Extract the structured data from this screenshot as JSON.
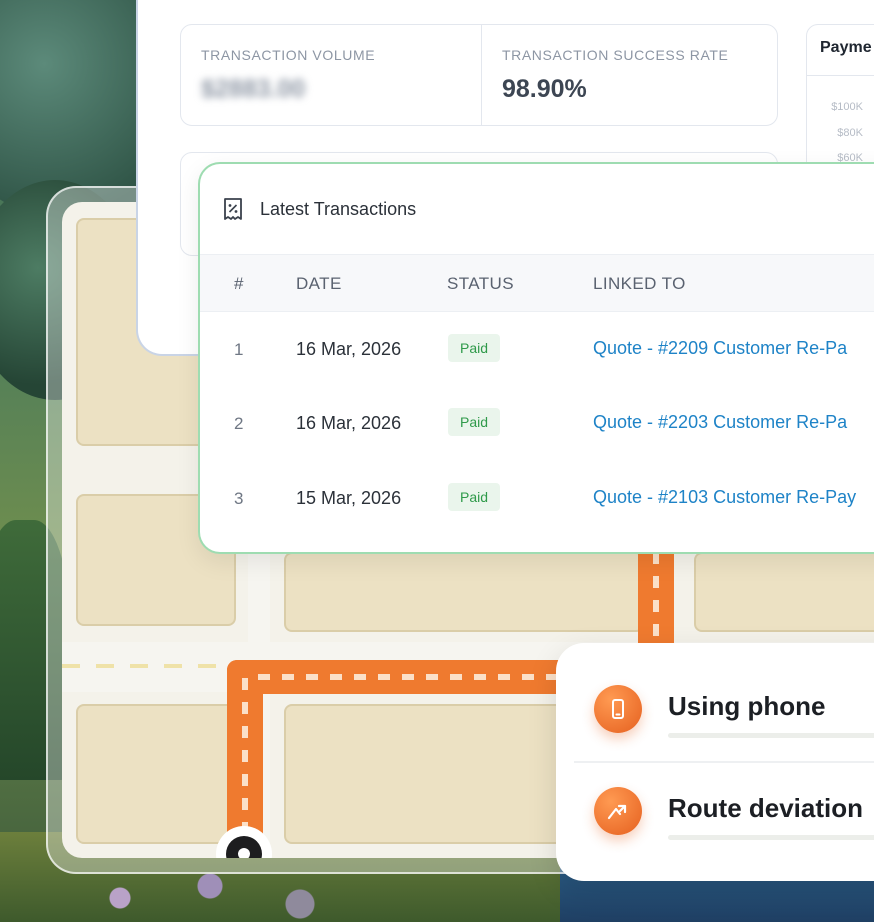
{
  "stats": {
    "volume_label": "TRANSACTION VOLUME",
    "volume_value": "$2883.00",
    "success_label": "TRANSACTION SUCCESS RATE",
    "success_value": "98.90%"
  },
  "payments_chart": {
    "title": "Payme",
    "ticks": [
      "$100K",
      "$80K",
      "$60K"
    ]
  },
  "transactions": {
    "title": "Latest Transactions",
    "columns": [
      "#",
      "DATE",
      "STATUS",
      "LINKED TO"
    ],
    "rows": [
      {
        "num": "1",
        "date": "16 Mar, 2026",
        "status": "Paid",
        "linked": "Quote - #2209 Customer Re-Pa"
      },
      {
        "num": "2",
        "date": "16 Mar, 2026",
        "status": "Paid",
        "linked": "Quote - #2203 Customer Re-Pa"
      },
      {
        "num": "3",
        "date": "15 Mar, 2026",
        "status": "Paid",
        "linked": "Quote - #2103 Customer Re-Pay"
      }
    ]
  },
  "alerts": [
    {
      "label": "Using phone",
      "icon": "phone-icon"
    },
    {
      "label": "Route deviation",
      "icon": "route-icon"
    }
  ],
  "colors": {
    "accent_orange": "#ef7a2f",
    "link_blue": "#1e83c7",
    "paid_green": "#2f9a4a",
    "table_border_green": "#9edcb1"
  }
}
